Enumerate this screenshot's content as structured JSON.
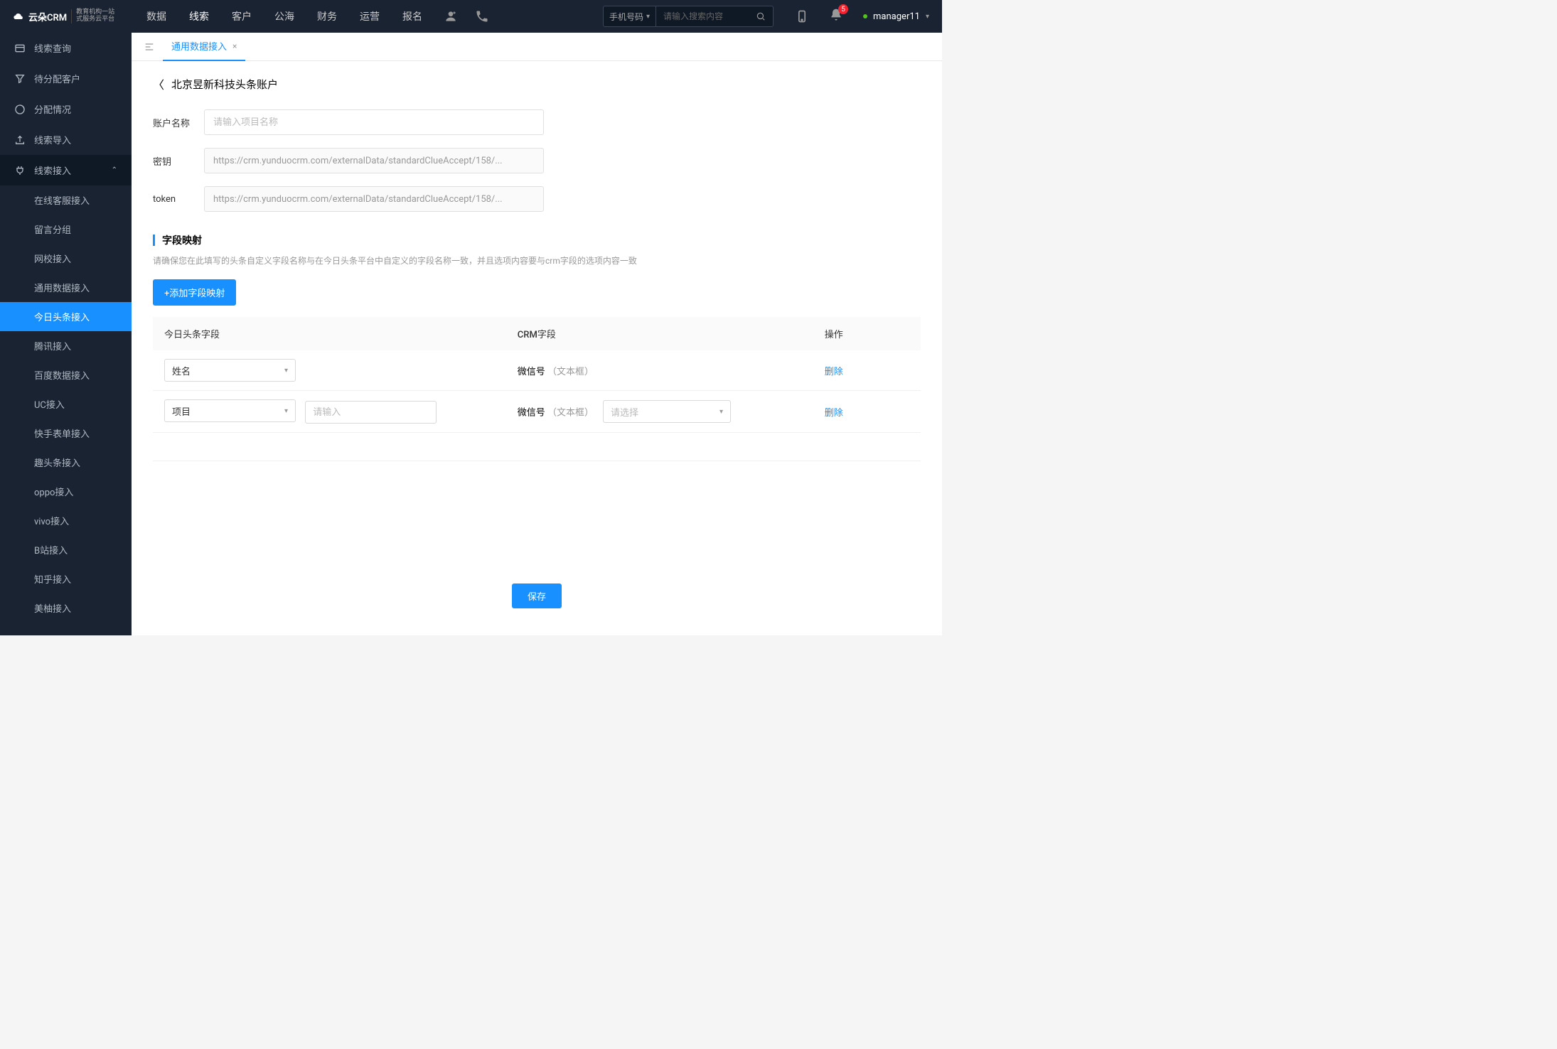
{
  "header": {
    "logo": "云朵CRM",
    "logo_sub1": "教育机构一站",
    "logo_sub2": "式服务云平台",
    "nav": [
      "数据",
      "线索",
      "客户",
      "公海",
      "财务",
      "运营",
      "报名"
    ],
    "nav_active_index": 1,
    "search_label": "手机号码",
    "search_placeholder": "请输入搜索内容",
    "badge_count": "5",
    "username": "manager11"
  },
  "sidebar": {
    "items": [
      {
        "label": "线索查询",
        "icon": "card"
      },
      {
        "label": "待分配客户",
        "icon": "filter"
      },
      {
        "label": "分配情况",
        "icon": "progress"
      },
      {
        "label": "线索导入",
        "icon": "export"
      },
      {
        "label": "线索接入",
        "icon": "plug",
        "expanded": true,
        "active_parent": true
      }
    ],
    "sub_items": [
      "在线客服接入",
      "留言分组",
      "网校接入",
      "通用数据接入",
      "今日头条接入",
      "腾讯接入",
      "百度数据接入",
      "UC接入",
      "快手表单接入",
      "趣头条接入",
      "oppo接入",
      "vivo接入",
      "B站接入",
      "知乎接入",
      "美柚接入"
    ],
    "sub_active_index": 4
  },
  "tabs": {
    "items": [
      {
        "label": "通用数据接入"
      }
    ]
  },
  "page": {
    "title": "北京昱新科技头条账户",
    "form": {
      "account_label": "账户名称",
      "account_placeholder": "请输入项目名称",
      "secret_label": "密钥",
      "secret_value": "https://crm.yunduocrm.com/externalData/standardClueAccept/158/...",
      "token_label": "token",
      "token_value": "https://crm.yunduocrm.com/externalData/standardClueAccept/158/..."
    },
    "mapping": {
      "title": "字段映射",
      "desc": "请确保您在此填写的头条自定义字段名称与在今日头条平台中自定义的字段名称一致，并且选项内容要与crm字段的选项内容一致",
      "add_btn": "+添加字段映射",
      "columns": [
        "今日头条字段",
        "CRM字段",
        "操作"
      ],
      "rows": [
        {
          "field1": "姓名",
          "crm_label": "微信号",
          "crm_hint": "（文本框）",
          "delete": "删除"
        },
        {
          "field1": "项目",
          "extra_placeholder": "请输入",
          "crm_label": "微信号",
          "crm_hint": "（文本框）",
          "crm_select_placeholder": "请选择",
          "delete": "删除"
        }
      ]
    },
    "save_btn": "保存"
  }
}
